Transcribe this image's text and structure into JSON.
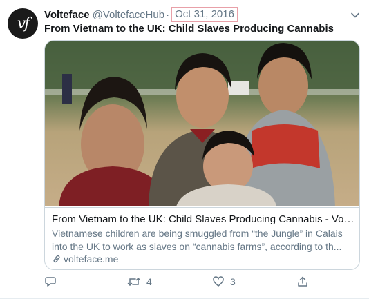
{
  "tweet": {
    "author_name": "Volteface",
    "author_handle": "@VoltefaceHub",
    "separator": "·",
    "date": "Oct 31, 2016",
    "avatar_text": "vf",
    "text": "From Vietnam to the UK: Child Slaves Producing Cannabis"
  },
  "card": {
    "title": "From Vietnam to the UK: Child Slaves Producing Cannabis - Voltef...",
    "description_line1": "Vietnamese children are being smuggled from “the Jungle” in Calais",
    "description_line2": "into the UK to work as slaves on “cannabis farms”, according to th...",
    "domain": "volteface.me"
  },
  "actions": {
    "retweet_count": "4",
    "like_count": "3"
  },
  "icons": {
    "menu": "chevron-down-icon",
    "reply": "reply-icon",
    "retweet": "retweet-icon",
    "like": "heart-icon",
    "share": "share-icon",
    "link": "link-icon"
  },
  "colors": {
    "text_primary": "#14171a",
    "text_secondary": "#657786",
    "date_highlight_border": "#e8a0a8"
  }
}
